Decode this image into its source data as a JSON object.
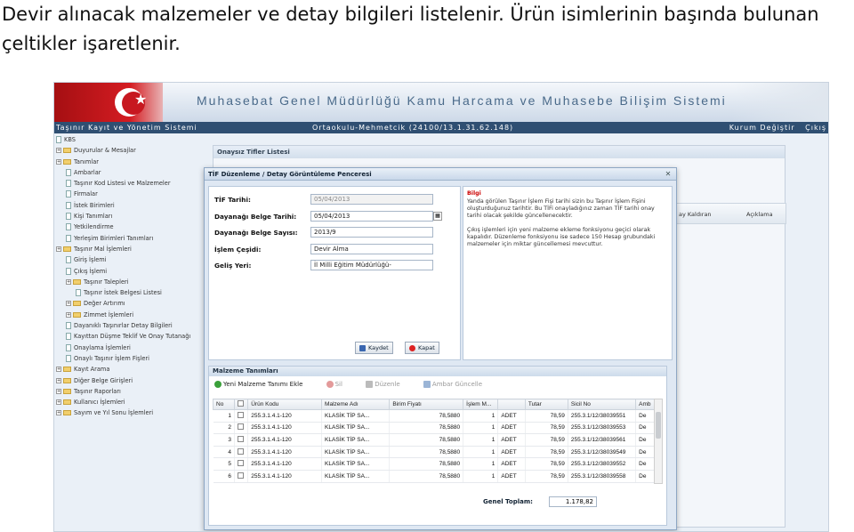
{
  "caption": "Devir alınacak malzemeler ve detay bilgileri listelenir. Ürün isimlerinin başında bulunan çeltikler işaretlenir.",
  "banner": {
    "title": "Muhasebat Genel Müdürlüğü Kamu Harcama ve Muhasebe Bilişim Sistemi"
  },
  "topbar": {
    "left": "Taşınır Kayıt ve Yönetim Sistemi",
    "middle": "Ortaokulu-Mehmetcik (24100/13.1.31.62.148)",
    "kurum": "Kurum Değiştir",
    "cikis": "Çıkış"
  },
  "tree": [
    {
      "label": "KBS",
      "level": 0,
      "type": "doc"
    },
    {
      "label": "Duyurular & Mesajlar",
      "level": 0,
      "type": "folder"
    },
    {
      "label": "Tanımlar",
      "level": 0,
      "type": "folder"
    },
    {
      "label": "Ambarlar",
      "level": 1,
      "type": "doc"
    },
    {
      "label": "Taşınır Kod Listesi ve Malzemeler",
      "level": 1,
      "type": "doc"
    },
    {
      "label": "Firmalar",
      "level": 1,
      "type": "doc"
    },
    {
      "label": "İstek Birimleri",
      "level": 1,
      "type": "doc"
    },
    {
      "label": "Kişi Tanımları",
      "level": 1,
      "type": "doc"
    },
    {
      "label": "Yetkilendirme",
      "level": 1,
      "type": "doc"
    },
    {
      "label": "Yerleşim Birimleri Tanımları",
      "level": 1,
      "type": "doc"
    },
    {
      "label": "Taşınır Mal İşlemleri",
      "level": 0,
      "type": "folder"
    },
    {
      "label": "Giriş İşlemi",
      "level": 1,
      "type": "doc"
    },
    {
      "label": "Çıkış İşlemi",
      "level": 1,
      "type": "doc"
    },
    {
      "label": "Taşınır Talepleri",
      "level": 1,
      "type": "folder"
    },
    {
      "label": "Taşınır İstek Belgesi Listesi",
      "level": 2,
      "type": "doc"
    },
    {
      "label": "Değer Artırımı",
      "level": 1,
      "type": "folder"
    },
    {
      "label": "Zimmet İşlemleri",
      "level": 1,
      "type": "folder"
    },
    {
      "label": "Dayanıklı Taşınırlar Detay Bilgileri",
      "level": 1,
      "type": "doc"
    },
    {
      "label": "Kayıttan Düşme Teklif Ve Onay Tutanağı",
      "level": 1,
      "type": "doc"
    },
    {
      "label": "Onaylama İşlemleri",
      "level": 1,
      "type": "doc"
    },
    {
      "label": "Onaylı Taşınır İşlem Fişleri",
      "level": 1,
      "type": "doc"
    },
    {
      "label": "Kayıt Arama",
      "level": 0,
      "type": "folder"
    },
    {
      "label": "Diğer Belge Girişleri",
      "level": 0,
      "type": "folder"
    },
    {
      "label": "Taşınır Raporları",
      "level": 0,
      "type": "folder"
    },
    {
      "label": "Kullanıcı İşlemleri",
      "level": 0,
      "type": "folder"
    },
    {
      "label": "Sayım ve Yıl Sonu İşlemleri",
      "level": 0,
      "type": "folder"
    }
  ],
  "back_panel": {
    "title": "Onaysız Tifler Listesi",
    "col1": "ay Kaldıran",
    "col2": "Açıklama"
  },
  "dialog": {
    "title": "TİF Düzenleme / Detay Görüntüleme Penceresi",
    "fields": [
      {
        "label": "TİF Tarihi:",
        "value": "05/04/2013",
        "disabled": true,
        "calendar": false
      },
      {
        "label": "Dayanağı Belge Tarihi:",
        "value": "05/04/2013",
        "disabled": false,
        "calendar": true
      },
      {
        "label": "Dayanağı Belge Sayısı:",
        "value": "2013/9",
        "disabled": false,
        "calendar": false
      },
      {
        "label": "İşlem Çeşidi:",
        "value": "Devir Alma",
        "disabled": false,
        "calendar": false
      },
      {
        "label": "Geliş Yeri:",
        "value": "İl Milli Eğitim Müdürlüğü-",
        "disabled": false,
        "calendar": false
      }
    ],
    "save_label": "Kaydet",
    "close_label": "Kapat",
    "info": {
      "title": "Bilgi",
      "p1": "Yanda görülen Taşınır İşlem Fişi tarihi sizin bu Taşınır İşlem Fişini oluşturduğunuz tarihtir. Bu TİFi onayladığınız zaman TİF tarihi onay tarihi olacak şekilde güncellenecektir.",
      "p2": "Çıkış işlemleri için yeni malzeme ekleme fonksiyonu geçici olarak kapalıdır. Düzenleme fonksiyonu ise sadece 150 Hesap grubundaki malzemeler için miktar güncellemesi mevcuttur."
    },
    "materials": {
      "title": "Malzeme Tanımları",
      "tools": {
        "add": "Yeni Malzeme Tanımı Ekle",
        "delete": "Sil",
        "edit": "Düzenle",
        "update": "Ambar Güncelle"
      },
      "columns": [
        "No",
        "",
        "Ürün Kodu",
        "Malzeme Adı",
        "Birim Fiyatı",
        "İşlem M...",
        "",
        "Tutar",
        "Sicil No",
        "Amb"
      ],
      "rows": [
        [
          "1",
          "",
          "255.3.1.4.1-120",
          "KLASİK TİP SA...",
          "78,5880",
          "1",
          "ADET",
          "78,59",
          "255.3.1/12/38039551",
          "De"
        ],
        [
          "2",
          "",
          "255.3.1.4.1-120",
          "KLASİK TİP SA...",
          "78,5880",
          "1",
          "ADET",
          "78,59",
          "255.3.1/12/38039553",
          "De"
        ],
        [
          "3",
          "",
          "255.3.1.4.1-120",
          "KLASİK TİP SA...",
          "78,5880",
          "1",
          "ADET",
          "78,59",
          "255.3.1/12/38039561",
          "De"
        ],
        [
          "4",
          "",
          "255.3.1.4.1-120",
          "KLASİK TİP SA...",
          "78,5880",
          "1",
          "ADET",
          "78,59",
          "255.3.1/12/38039549",
          "De"
        ],
        [
          "5",
          "",
          "255.3.1.4.1-120",
          "KLASİK TİP SA...",
          "78,5880",
          "1",
          "ADET",
          "78,59",
          "255.3.1/12/38039552",
          "De"
        ],
        [
          "6",
          "",
          "255.3.1.4.1-120",
          "KLASİK TİP SA...",
          "78,5880",
          "1",
          "ADET",
          "78,59",
          "255.3.1/12/38039558",
          "De"
        ]
      ],
      "total_label": "Genel Toplam:",
      "total_value": "1.178,82"
    }
  },
  "colors": {
    "accent": "#2f4f72",
    "flag": "#c71820",
    "info_title": "#cc0000"
  }
}
